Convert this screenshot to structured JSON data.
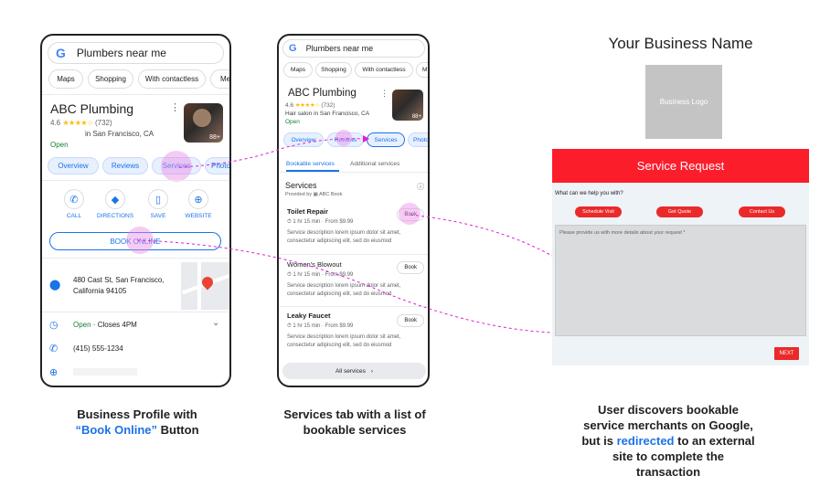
{
  "phone1": {
    "search": "Plumbers near me",
    "chips": [
      "Maps",
      "Shopping",
      "With contactless",
      "Me"
    ],
    "biz_name": "ABC Plumbing",
    "rating": "4.6",
    "stars": "★★★★☆",
    "reviews_count": "(732)",
    "location": "in San Francisco, CA",
    "open": "Open",
    "photo_count": "88+",
    "tabs": [
      "Overview",
      "Reviews",
      "Services",
      "Photo"
    ],
    "actions": [
      "CALL",
      "DIRECTIONS",
      "SAVE",
      "WEBSITE"
    ],
    "book_online": "BOOK ONLINE",
    "address_line1": "480 Cast St, San Francisco,",
    "address_line2": "California 94105",
    "hours_open": "Open",
    "hours_close": " · Closes 4PM",
    "phone": "(415) 555-1234"
  },
  "phone2": {
    "search": "Plumbers near me",
    "chips": [
      "Maps",
      "Shopping",
      "With contactless",
      "M"
    ],
    "biz_name": "ABC Plumbing",
    "rating": "4.6",
    "stars": "★★★★☆",
    "reviews_count": "(732)",
    "category": "Hair salon in San Francisco, CA",
    "open": "Open",
    "photo_count": "88+",
    "tabs": [
      "Overview",
      "Reviews",
      "Services",
      "Photo"
    ],
    "subtabs": [
      "Bookable services",
      "Additional services"
    ],
    "services_title": "Services",
    "provided_by": "Provided by ▦ ABC Book",
    "services": [
      {
        "name": "Toilet Repair",
        "meta": "⏱ 1 hr 15 min · From $9.99",
        "desc": "Service description lorem ipsum dolor sit amet, consectetur adipiscing elit, sed do eiusmod",
        "book": "Book"
      },
      {
        "name": "Women's Blowout",
        "meta": "⏱ 1 hr 15 min · From $9.99",
        "desc": "Service description lorem ipsum dolor sit amet, consectetur adipiscing elit, sed do eiusmod",
        "book": "Book"
      },
      {
        "name": "Leaky Faucet",
        "meta": "⏱ 1 hr 15 min · From $9.99",
        "desc": "Service description lorem ipsum dolor sit amet, consectetur adipiscing elit, sed do eiusmod",
        "book": "Book"
      }
    ],
    "all_services": "All services"
  },
  "site": {
    "business_name": "Your Business Name",
    "logo": "Business Logo",
    "form_title": "Service Request",
    "question": "What can we help you with?",
    "options": [
      "Schedule Visit",
      "Get Quote",
      "Contact Us"
    ],
    "textarea_placeholder": "Please provide us with more details about your request *",
    "next": "NEXT"
  },
  "captions": {
    "c1_line1": "Business Profile with",
    "c1_blue": "“Book Online”",
    "c1_rest": " Button",
    "c2_line1": "Services tab with a list of",
    "c2_line2": "bookable services",
    "c3_line1": "User discovers bookable",
    "c3_line2": "service merchants on Google,",
    "c3_line3a": "but is ",
    "c3_blue": "redirected",
    "c3_line3b": " to an external",
    "c3_line4": "site to complete the",
    "c3_line5": "transaction"
  },
  "colors": {
    "accent_blue": "#1a73e8",
    "form_red": "#ea2a2a",
    "highlight_pink": "#e88ce6",
    "connector_magenta": "#e020d0"
  }
}
